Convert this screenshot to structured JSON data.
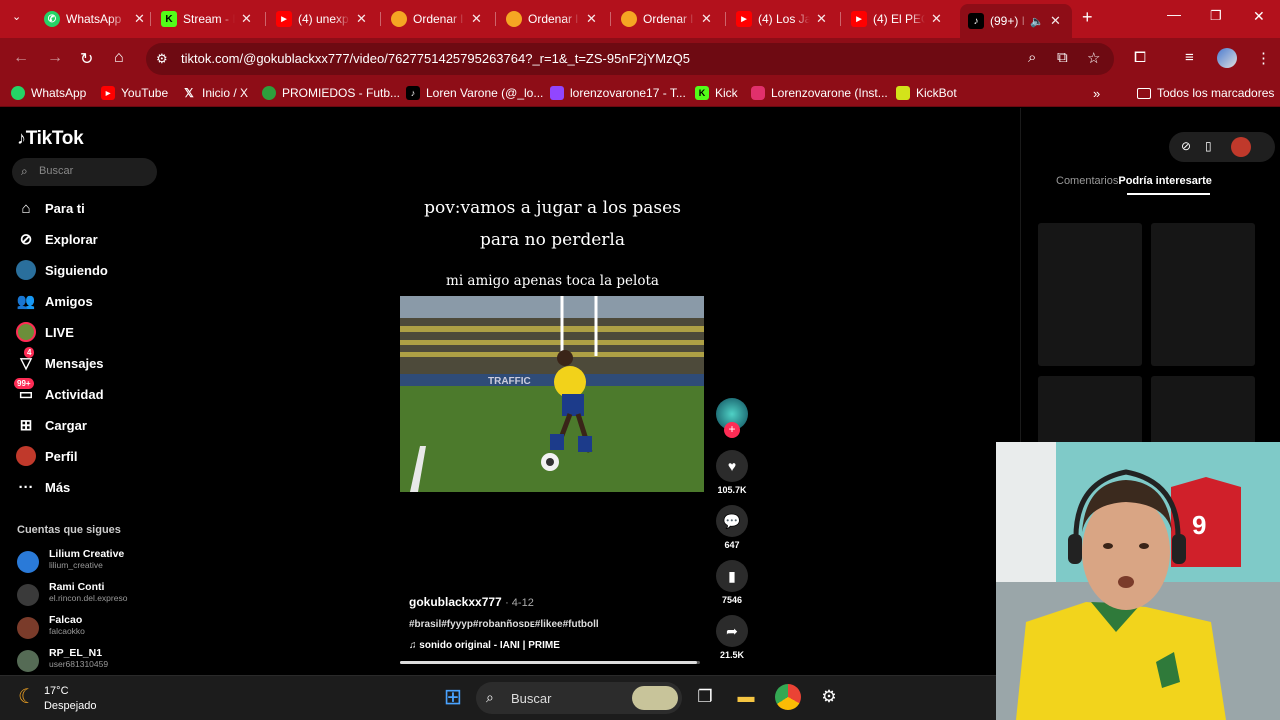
{
  "browser": {
    "tabs": [
      {
        "title": "WhatsApp",
        "favicon": "whatsapp-icon",
        "color": "#25d366"
      },
      {
        "title": "Stream - I",
        "favicon": "kick-icon",
        "color": "#53fc18"
      },
      {
        "title": "(4) unexp",
        "favicon": "youtube-icon",
        "color": "#ff0000"
      },
      {
        "title": "Ordenar l",
        "favicon": "orange-icon",
        "color": "#f5a623"
      },
      {
        "title": "Ordenar l",
        "favicon": "orange-icon",
        "color": "#f5a623"
      },
      {
        "title": "Ordenar l",
        "favicon": "orange-icon",
        "color": "#f5a623"
      },
      {
        "title": "(4) Los Ja",
        "favicon": "youtube-icon",
        "color": "#ff0000"
      },
      {
        "title": "(4) El PEO",
        "favicon": "youtube-icon",
        "color": "#ff0000"
      },
      {
        "title": "(99+) I",
        "favicon": "tiktok-icon",
        "color": "#000000"
      }
    ],
    "url": "tiktok.com/@gokublackxx777/video/7627751425795263764?_r=1&_t=ZS-95nF2jYMzQ5",
    "bookmarks": [
      {
        "label": "WhatsApp",
        "icon": "whatsapp-icon",
        "color": "#25d366"
      },
      {
        "label": "YouTube",
        "icon": "youtube-icon",
        "color": "#ff0000"
      },
      {
        "label": "Inicio / X",
        "icon": "x-icon",
        "color": "#000000"
      },
      {
        "label": "PROMIEDOS - Futb...",
        "icon": "promiedos-icon",
        "color": "#2e9e3c"
      },
      {
        "label": "Loren Varone (@_lo...",
        "icon": "tiktok-icon",
        "color": "#000000"
      },
      {
        "label": "lorenzovarone17 - T...",
        "icon": "twitch-icon",
        "color": "#9146ff"
      },
      {
        "label": "Kick",
        "icon": "kick-icon",
        "color": "#53fc18"
      },
      {
        "label": "Lorenzovarone (Inst...",
        "icon": "instagram-icon",
        "color": "#e1306c"
      },
      {
        "label": "KickBot",
        "icon": "kickbot-icon",
        "color": "#d3e31a"
      }
    ],
    "all_bookmarks": "Todos los marcadores",
    "chrome_color": "#8e0d17"
  },
  "tiktok": {
    "logo": "TikTok",
    "search_placeholder": "Buscar",
    "nav": [
      {
        "label": "Para ti",
        "icon": "home-icon"
      },
      {
        "label": "Explorar",
        "icon": "compass-icon"
      },
      {
        "label": "Siguiendo",
        "icon": "following-icon"
      },
      {
        "label": "Amigos",
        "icon": "friends-icon"
      },
      {
        "label": "LIVE",
        "icon": "live-icon"
      },
      {
        "label": "Mensajes",
        "icon": "messages-icon",
        "badge": "4"
      },
      {
        "label": "Actividad",
        "icon": "activity-icon",
        "badge": "99+"
      },
      {
        "label": "Cargar",
        "icon": "upload-icon"
      },
      {
        "label": "Perfil",
        "icon": "profile-icon"
      },
      {
        "label": "Más",
        "icon": "more-icon"
      }
    ],
    "following_header": "Cuentas que sigues",
    "following": [
      {
        "name": "Lilium Creative",
        "user": "lilium_creative",
        "color": "#2a7ad8"
      },
      {
        "name": "Rami Conti",
        "user": "el.rincon.del.expreso",
        "color": "#3a3a3a"
      },
      {
        "name": "Falcao",
        "user": "falcaokko",
        "color": "#7a3b2a"
      },
      {
        "name": "RP_EL_N1",
        "user": "user681310459",
        "color": "#556b55"
      }
    ],
    "video": {
      "caption_line1": "pov:vamos a jugar a los pases",
      "caption_line2": "para no perderla",
      "caption_line3": "mi amigo apenas toca la pelota",
      "author": "gokublackxx777",
      "date": "4-12",
      "hashtags": "#brasil#fyyyp#robanñosᴅᴇ#likee#futboll",
      "sound": "sonido original - IANI | PRIME",
      "progress": 0.99
    },
    "actions": {
      "likes": "105.7K",
      "comments": "647",
      "saves": "7546",
      "shares": "21.5K"
    },
    "right_panel": {
      "tab_comments": "Comentarios",
      "tab_suggested": "Podría interesarte"
    }
  },
  "taskbar": {
    "temperature": "17°C",
    "weather": "Despejado",
    "search": "Buscar"
  }
}
